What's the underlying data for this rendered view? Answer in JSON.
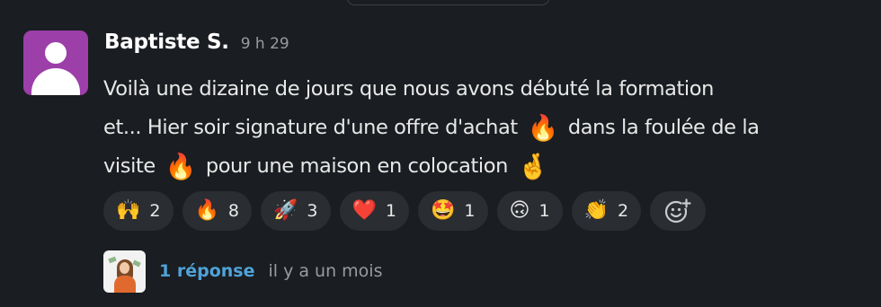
{
  "message": {
    "author": "Baptiste S.",
    "timestamp": "9 h 29",
    "line1": "Voilà une dizaine de jours que nous avons débuté la formation",
    "line2_a": "et... Hier soir signature d'une offre d'achat",
    "line2_b": "dans la foulée de la",
    "line3_a": "visite",
    "line3_b": "pour une maison en colocation",
    "inline_emoji_fire": "🔥",
    "inline_emoji_crossed": "🤞"
  },
  "reactions": [
    {
      "emoji": "🙌",
      "icon": "raised-hands-icon",
      "count": "2"
    },
    {
      "emoji": "🔥",
      "icon": "fire-icon",
      "count": "8"
    },
    {
      "emoji": "🚀",
      "icon": "rocket-icon",
      "count": "3"
    },
    {
      "emoji": "❤️",
      "icon": "heart-icon",
      "count": "1"
    },
    {
      "emoji": "🤩",
      "icon": "star-struck-icon",
      "count": "1"
    },
    {
      "emoji": "🙃",
      "icon": "upside-down-face-icon",
      "count": "1"
    },
    {
      "emoji": "👏",
      "icon": "clapping-hands-icon",
      "count": "2"
    }
  ],
  "thread": {
    "reply_label": "1 réponse",
    "reply_time": "il y a un mois"
  },
  "colors": {
    "background": "#1a1d21",
    "avatar": "#9c3fa8",
    "link": "#4fa3d9",
    "reaction_bg": "#2a2d31"
  }
}
